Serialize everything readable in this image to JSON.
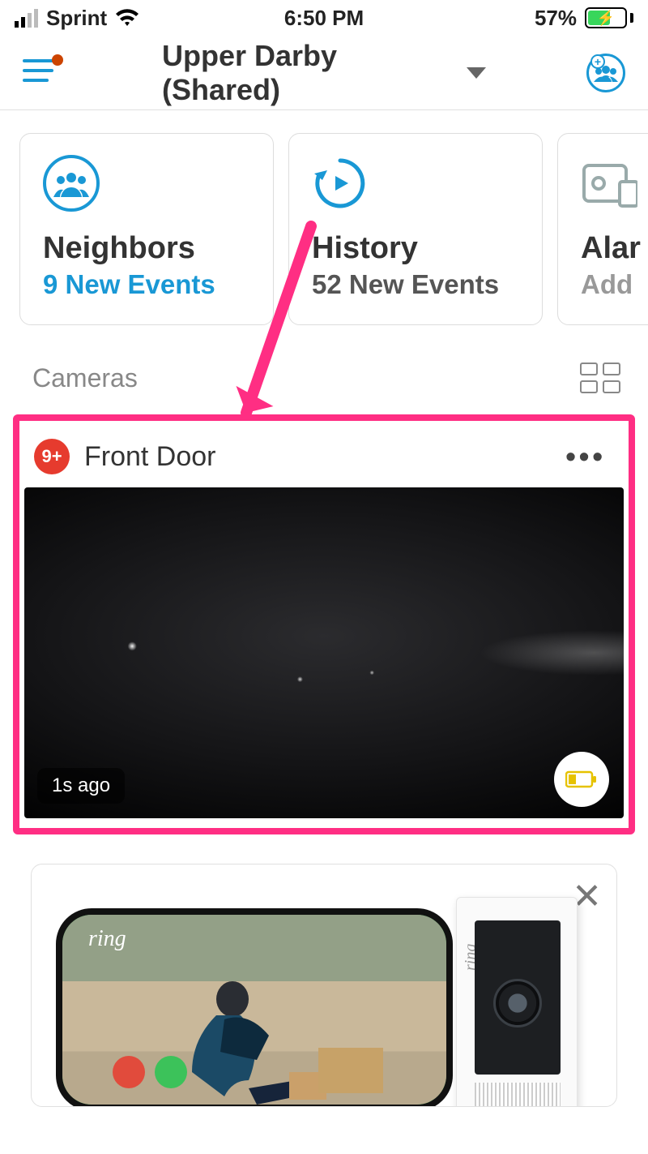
{
  "status": {
    "carrier": "Sprint",
    "time": "6:50 PM",
    "battery_pct": "57%"
  },
  "nav": {
    "location_title": "Upper Darby (Shared)"
  },
  "tiles": {
    "neighbors": {
      "title": "Neighbors",
      "subtitle": "9 New Events"
    },
    "history": {
      "title": "History",
      "subtitle": "52 New Events"
    },
    "alarm": {
      "title": "Alar",
      "subtitle": "Add"
    }
  },
  "section": {
    "cameras_label": "Cameras"
  },
  "camera": {
    "badge": "9+",
    "name": "Front Door",
    "timestamp": "1s ago"
  },
  "promo": {
    "phone_logo": "ring",
    "device_logo": "ring"
  }
}
